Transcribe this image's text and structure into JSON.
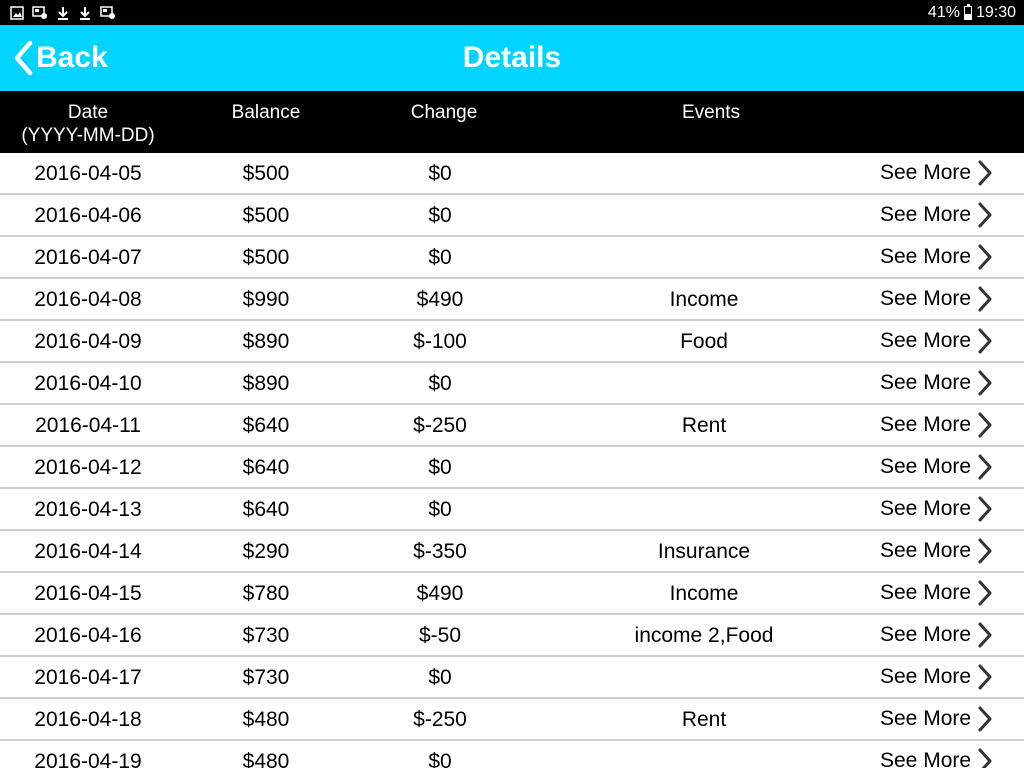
{
  "status_bar": {
    "battery": "41%",
    "time": "19:30",
    "notification_icons": [
      "image-icon",
      "screenshot-icon",
      "download-icon",
      "download-icon",
      "screenshot-icon"
    ]
  },
  "header": {
    "back_label": "Back",
    "title": "Details",
    "background_color": "#00d4ff"
  },
  "table": {
    "columns": {
      "date": "Date",
      "date_format": "(YYYY-MM-DD)",
      "balance": "Balance",
      "change": "Change",
      "events": "Events"
    },
    "see_more_label": "See More",
    "rows": [
      {
        "date": "2016-04-05",
        "balance": "$500",
        "change": "$0",
        "events": ""
      },
      {
        "date": "2016-04-06",
        "balance": "$500",
        "change": "$0",
        "events": ""
      },
      {
        "date": "2016-04-07",
        "balance": "$500",
        "change": "$0",
        "events": ""
      },
      {
        "date": "2016-04-08",
        "balance": "$990",
        "change": "$490",
        "events": "Income"
      },
      {
        "date": "2016-04-09",
        "balance": "$890",
        "change": "$-100",
        "events": "Food"
      },
      {
        "date": "2016-04-10",
        "balance": "$890",
        "change": "$0",
        "events": ""
      },
      {
        "date": "2016-04-11",
        "balance": "$640",
        "change": "$-250",
        "events": "Rent"
      },
      {
        "date": "2016-04-12",
        "balance": "$640",
        "change": "$0",
        "events": ""
      },
      {
        "date": "2016-04-13",
        "balance": "$640",
        "change": "$0",
        "events": ""
      },
      {
        "date": "2016-04-14",
        "balance": "$290",
        "change": "$-350",
        "events": "Insurance"
      },
      {
        "date": "2016-04-15",
        "balance": "$780",
        "change": "$490",
        "events": "Income"
      },
      {
        "date": "2016-04-16",
        "balance": "$730",
        "change": "$-50",
        "events": "income 2,Food"
      },
      {
        "date": "2016-04-17",
        "balance": "$730",
        "change": "$0",
        "events": ""
      },
      {
        "date": "2016-04-18",
        "balance": "$480",
        "change": "$-250",
        "events": "Rent"
      },
      {
        "date": "2016-04-19",
        "balance": "$480",
        "change": "$0",
        "events": ""
      }
    ]
  }
}
